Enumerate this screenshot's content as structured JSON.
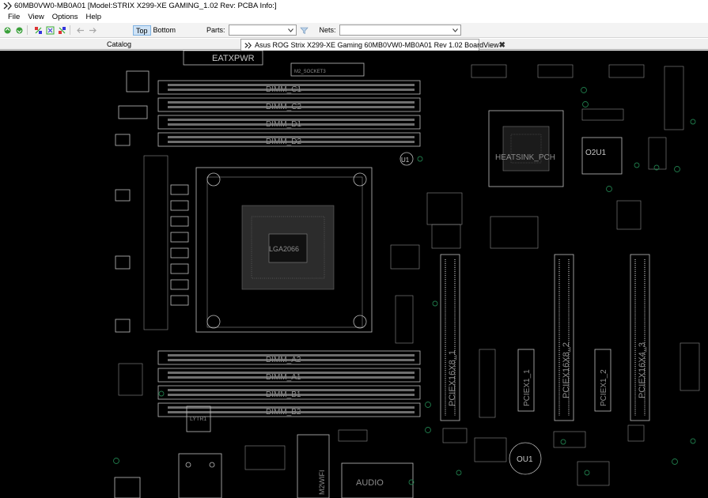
{
  "window": {
    "title": "60MB0VW0-MB0A01 [Model:STRIX X299-XE GAMING_1.02 Rev: PCBA Info:]",
    "icon": "app-icon"
  },
  "menu": {
    "items": [
      "File",
      "View",
      "Options",
      "Help"
    ]
  },
  "toolbar": {
    "top_label": "Top",
    "bottom_label": "Bottom",
    "active_side": "Top",
    "parts_label": "Parts:",
    "parts_value": "",
    "nets_label": "Nets:",
    "nets_value": ""
  },
  "tabs": {
    "catalog_label": "Catalog",
    "board_label": "Asus ROG Strix X299-XE Gaming 60MB0VW0-MB0A01 Rev 1.02 BoardView"
  },
  "board": {
    "connector_labels": {
      "eatxpwr": "EATXPWR",
      "dimm_c1": "DIMM_C1",
      "dimm_c2": "DIMM_C2",
      "dimm_d1": "DIMM_D1",
      "dimm_d2": "DIMM_D2",
      "dimm_a2": "DIMM_A2",
      "dimm_a1": "DIMM_A1",
      "dimm_b1": "DIMM_B1",
      "dimm_b2": "DIMM_B2",
      "pciex16_1": "PCIEX16X8_1",
      "pciex16_2": "PCIEX16X8_2",
      "pciex16_3": "PCIEX16X4_3",
      "pciex1_1": "PCIEX1_1",
      "pciex1_2": "PCIEX1_2",
      "heatsink": "HEATSINK_PCH",
      "cpu_socket": "LGA2066",
      "o2u1": "O2U1",
      "ou1": "OU1",
      "u1": "U1",
      "m2_wifi": "M2WIFI",
      "audio": "AUDIO",
      "lytr1": "LYTR1",
      "m2_socket": "M2_SOCKET3"
    },
    "colors": {
      "background": "#000000",
      "silkscreen": "#bdbdbd",
      "testpoint": "#1f7a4a"
    }
  }
}
